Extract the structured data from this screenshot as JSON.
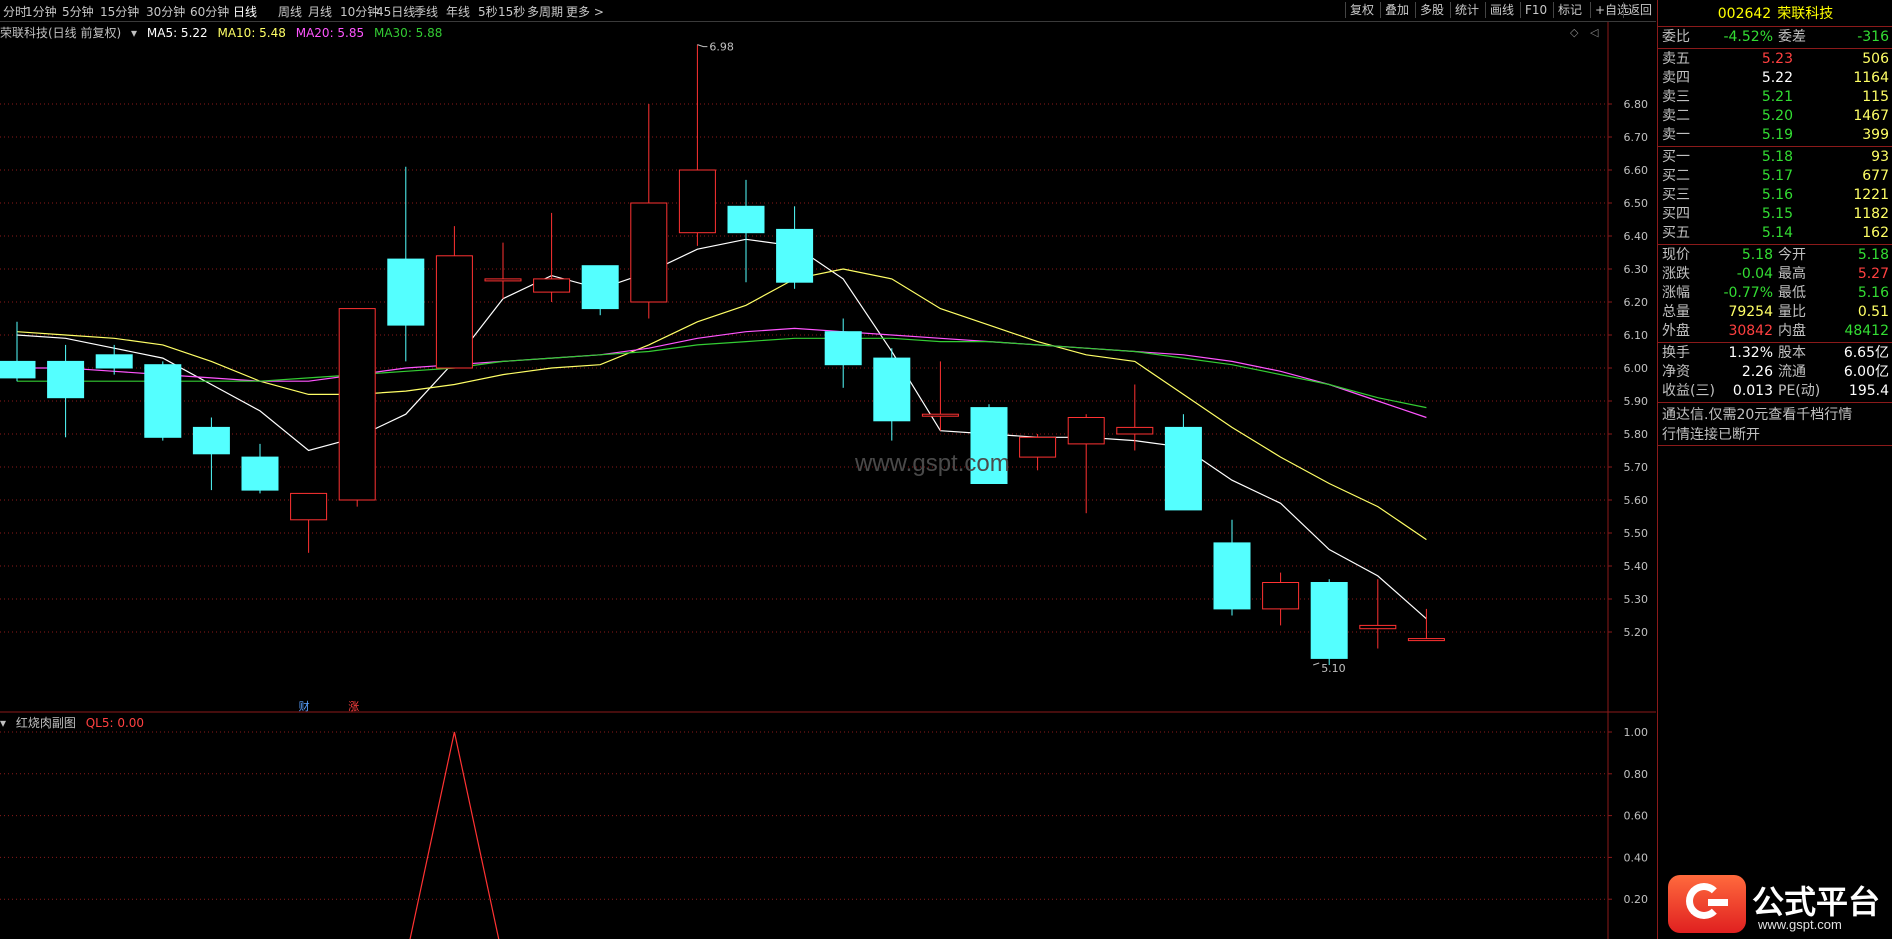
{
  "toolbar": {
    "tabs": [
      "分时",
      "1分钟",
      "5分钟",
      "15分钟",
      "30分钟",
      "60分钟",
      "日线",
      "周线",
      "月线",
      "10分钟",
      "45日线",
      "季线",
      "年线",
      "5秒",
      "15秒",
      "多周期",
      "更多 >"
    ],
    "active_tab": "日线",
    "right_buttons": [
      "复权",
      "叠加",
      "多股",
      "统计",
      "画线",
      "F10",
      "标记",
      "+自选",
      "返回"
    ]
  },
  "main_legend": {
    "stock_label": "荣联科技(日线 前复权)",
    "ma5": "MA5: 5.22",
    "ma10": "MA10: 5.48",
    "ma20": "MA20: 5.85",
    "ma30": "MA30: 5.88"
  },
  "sub_legend": {
    "name": "红烧肉副图",
    "ql5": "QL5: 0.00"
  },
  "annotations": {
    "high_label": "6.98",
    "low_label": "5.10",
    "marker_cai": "财",
    "marker_zhang": "涨"
  },
  "colors": {
    "up": "#ff3232",
    "down": "#54ffff",
    "ma5": "#ffffff",
    "ma10": "#ffff66",
    "ma20": "#ff55ff",
    "ma30": "#33cc33",
    "grid": "#8b1a1a"
  },
  "chart_data": [
    {
      "type": "candlestick",
      "title": "荣联科技(日线 前复权)",
      "y_ticks": [
        "6.80",
        "6.70",
        "6.60",
        "6.50",
        "6.40",
        "6.30",
        "6.20",
        "6.10",
        "6.00",
        "5.90",
        "5.80",
        "5.70",
        "5.60",
        "5.50",
        "5.40",
        "5.30",
        "5.20"
      ],
      "ylim": [
        5.05,
        7.05
      ],
      "candles": [
        {
          "o": 6.02,
          "h": 6.14,
          "l": 5.96,
          "c": 5.97
        },
        {
          "o": 6.02,
          "h": 6.07,
          "l": 5.79,
          "c": 5.91
        },
        {
          "o": 6.04,
          "h": 6.07,
          "l": 5.98,
          "c": 6.0
        },
        {
          "o": 6.01,
          "h": 6.02,
          "l": 5.78,
          "c": 5.79
        },
        {
          "o": 5.82,
          "h": 5.85,
          "l": 5.63,
          "c": 5.74
        },
        {
          "o": 5.73,
          "h": 5.77,
          "l": 5.62,
          "c": 5.63
        },
        {
          "o": 5.54,
          "h": 5.62,
          "l": 5.44,
          "c": 5.62
        },
        {
          "o": 5.6,
          "h": 6.18,
          "l": 5.58,
          "c": 6.18
        },
        {
          "o": 6.33,
          "h": 6.61,
          "l": 6.02,
          "c": 6.13
        },
        {
          "o": 6.0,
          "h": 6.43,
          "l": 6.0,
          "c": 6.34
        },
        {
          "o": 6.27,
          "h": 6.38,
          "l": 6.21,
          "c": 6.27
        },
        {
          "o": 6.23,
          "h": 6.47,
          "l": 6.2,
          "c": 6.27
        },
        {
          "o": 6.31,
          "h": 6.31,
          "l": 6.16,
          "c": 6.18
        },
        {
          "o": 6.2,
          "h": 6.8,
          "l": 6.15,
          "c": 6.5
        },
        {
          "o": 6.41,
          "h": 6.98,
          "l": 6.37,
          "c": 6.6
        },
        {
          "o": 6.49,
          "h": 6.57,
          "l": 6.26,
          "c": 6.41
        },
        {
          "o": 6.42,
          "h": 6.49,
          "l": 6.24,
          "c": 6.26
        },
        {
          "o": 6.11,
          "h": 6.15,
          "l": 5.94,
          "c": 6.01
        },
        {
          "o": 6.03,
          "h": 6.06,
          "l": 5.78,
          "c": 5.84
        },
        {
          "o": 5.86,
          "h": 6.02,
          "l": 5.81,
          "c": 5.86
        },
        {
          "o": 5.88,
          "h": 5.89,
          "l": 5.65,
          "c": 5.65
        },
        {
          "o": 5.73,
          "h": 5.8,
          "l": 5.69,
          "c": 5.79
        },
        {
          "o": 5.77,
          "h": 5.86,
          "l": 5.56,
          "c": 5.85
        },
        {
          "o": 5.8,
          "h": 5.95,
          "l": 5.75,
          "c": 5.82
        },
        {
          "o": 5.82,
          "h": 5.86,
          "l": 5.57,
          "c": 5.57
        },
        {
          "o": 5.47,
          "h": 5.54,
          "l": 5.25,
          "c": 5.27
        },
        {
          "o": 5.27,
          "h": 5.38,
          "l": 5.22,
          "c": 5.35
        },
        {
          "o": 5.35,
          "h": 5.36,
          "l": 5.1,
          "c": 5.12
        },
        {
          "o": 5.21,
          "h": 5.36,
          "l": 5.15,
          "c": 5.22
        },
        {
          "o": 5.18,
          "h": 5.27,
          "l": 5.18,
          "c": 5.18
        }
      ],
      "series": [
        {
          "name": "MA5",
          "values": [
            6.1,
            6.09,
            6.06,
            6.03,
            5.95,
            5.87,
            5.75,
            5.79,
            5.86,
            6.02,
            6.21,
            6.28,
            6.24,
            6.29,
            6.36,
            6.39,
            6.37,
            6.27,
            6.05,
            5.81,
            5.8,
            5.79,
            5.79,
            5.78,
            5.76,
            5.66,
            5.59,
            5.45,
            5.37,
            5.24
          ]
        },
        {
          "name": "MA10",
          "values": [
            6.11,
            6.1,
            6.09,
            6.07,
            6.02,
            5.96,
            5.92,
            5.92,
            5.93,
            5.95,
            5.98,
            6.0,
            6.01,
            6.07,
            6.14,
            6.19,
            6.27,
            6.3,
            6.27,
            6.18,
            6.13,
            6.08,
            6.04,
            6.02,
            5.92,
            5.82,
            5.73,
            5.65,
            5.58,
            5.48
          ]
        },
        {
          "name": "MA20",
          "values": [
            6.0,
            6.0,
            5.99,
            5.98,
            5.97,
            5.96,
            5.96,
            5.98,
            6.0,
            6.01,
            6.02,
            6.03,
            6.04,
            6.06,
            6.09,
            6.11,
            6.12,
            6.11,
            6.1,
            6.09,
            6.08,
            6.07,
            6.06,
            6.05,
            6.04,
            6.02,
            5.99,
            5.95,
            5.9,
            5.85
          ]
        },
        {
          "name": "MA30",
          "values": [
            5.96,
            5.96,
            5.96,
            5.96,
            5.96,
            5.96,
            5.97,
            5.98,
            5.99,
            6.0,
            6.02,
            6.03,
            6.04,
            6.05,
            6.07,
            6.08,
            6.09,
            6.09,
            6.09,
            6.08,
            6.08,
            6.07,
            6.06,
            6.05,
            6.03,
            6.01,
            5.98,
            5.95,
            5.91,
            5.88
          ]
        }
      ]
    },
    {
      "type": "line",
      "title": "红烧肉副图",
      "y_ticks": [
        "1.00",
        "0.80",
        "0.60",
        "0.40",
        "0.20"
      ],
      "ylim": [
        -0.12,
        1.05
      ],
      "series": [
        {
          "name": "QL5",
          "values": [
            0,
            0,
            0,
            0,
            0,
            0,
            0,
            0,
            0,
            1,
            0,
            0,
            0,
            0,
            0,
            0,
            0,
            0,
            0,
            0,
            0,
            0,
            0,
            0,
            0,
            0,
            0,
            0,
            0,
            0
          ]
        }
      ]
    }
  ],
  "quote_panel": {
    "code": "002642",
    "name": "荣联科技",
    "weibi_label": "委比",
    "weibi": "-4.52%",
    "weicha_label": "委差",
    "weicha": "-316",
    "asks": [
      {
        "label": "卖五",
        "price": "5.23",
        "vol": "506",
        "price_color": "#ff4040"
      },
      {
        "label": "卖四",
        "price": "5.22",
        "vol": "1164",
        "price_color": "#ffffff"
      },
      {
        "label": "卖三",
        "price": "5.21",
        "vol": "115",
        "price_color": "#33dd33"
      },
      {
        "label": "卖二",
        "price": "5.20",
        "vol": "1467",
        "price_color": "#33dd33"
      },
      {
        "label": "卖一",
        "price": "5.19",
        "vol": "399",
        "price_color": "#33dd33"
      }
    ],
    "bids": [
      {
        "label": "买一",
        "price": "5.18",
        "vol": "93",
        "price_color": "#33dd33"
      },
      {
        "label": "买二",
        "price": "5.17",
        "vol": "677",
        "price_color": "#33dd33"
      },
      {
        "label": "买三",
        "price": "5.16",
        "vol": "1221",
        "price_color": "#33dd33"
      },
      {
        "label": "买四",
        "price": "5.15",
        "vol": "1182",
        "price_color": "#33dd33"
      },
      {
        "label": "买五",
        "price": "5.14",
        "vol": "162",
        "price_color": "#33dd33"
      }
    ],
    "stats": [
      {
        "l1": "现价",
        "v1": "5.18",
        "c1": "#33dd33",
        "l2": "今开",
        "v2": "5.18",
        "c2": "#33dd33"
      },
      {
        "l1": "涨跌",
        "v1": "-0.04",
        "c1": "#33dd33",
        "l2": "最高",
        "v2": "5.27",
        "c2": "#ff4040"
      },
      {
        "l1": "涨幅",
        "v1": "-0.77%",
        "c1": "#33dd33",
        "l2": "最低",
        "v2": "5.16",
        "c2": "#33dd33"
      },
      {
        "l1": "总量",
        "v1": "79254",
        "c1": "#ffff66",
        "l2": "量比",
        "v2": "0.51",
        "c2": "#ffff66"
      },
      {
        "l1": "外盘",
        "v1": "30842",
        "c1": "#ff4040",
        "l2": "内盘",
        "v2": "48412",
        "c2": "#33dd33"
      }
    ],
    "finance": [
      {
        "l1": "换手",
        "v1": "1.32%",
        "l2": "股本",
        "v2": "6.65亿"
      },
      {
        "l1": "净资",
        "v1": "2.26",
        "l2": "流通",
        "v2": "6.00亿"
      },
      {
        "l1": "收益(三)",
        "v1": "0.013",
        "l2": "PE(动)",
        "v2": "195.4"
      }
    ],
    "notice1": "通达信.仅需20元查看千档行情",
    "notice2": "行情连接已断开"
  },
  "watermark": "www.gspt.com",
  "logo": {
    "name": "公式平台",
    "url": "www.gspt.com"
  }
}
